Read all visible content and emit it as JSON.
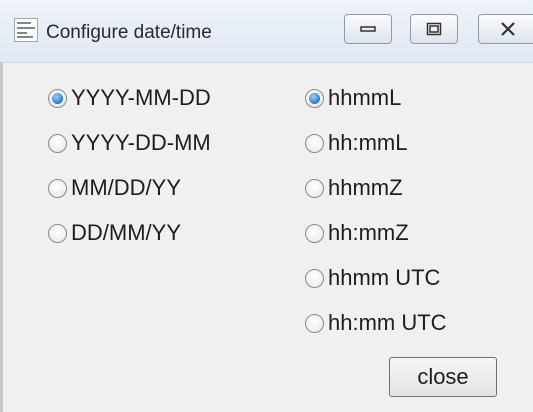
{
  "window": {
    "title": "Configure date/time",
    "controls": {
      "minimize": "minimize-icon",
      "maximize": "maximize-icon",
      "close": "close-x-icon"
    }
  },
  "date_formats": [
    {
      "label": "YYYY-MM-DD",
      "checked": true
    },
    {
      "label": "YYYY-DD-MM",
      "checked": false
    },
    {
      "label": "MM/DD/YY",
      "checked": false
    },
    {
      "label": "DD/MM/YY",
      "checked": false
    }
  ],
  "time_formats": [
    {
      "label": "hhmmL",
      "checked": true
    },
    {
      "label": "hh:mmL",
      "checked": false
    },
    {
      "label": "hhmmZ",
      "checked": false
    },
    {
      "label": "hh:mmZ",
      "checked": false
    },
    {
      "label": "hhmm UTC",
      "checked": false
    },
    {
      "label": "hh:mm UTC",
      "checked": false
    }
  ],
  "close_button": {
    "label": "close"
  },
  "colors": {
    "radio_selected": "#1e7be0",
    "titlebar": "#dfe8f3"
  }
}
